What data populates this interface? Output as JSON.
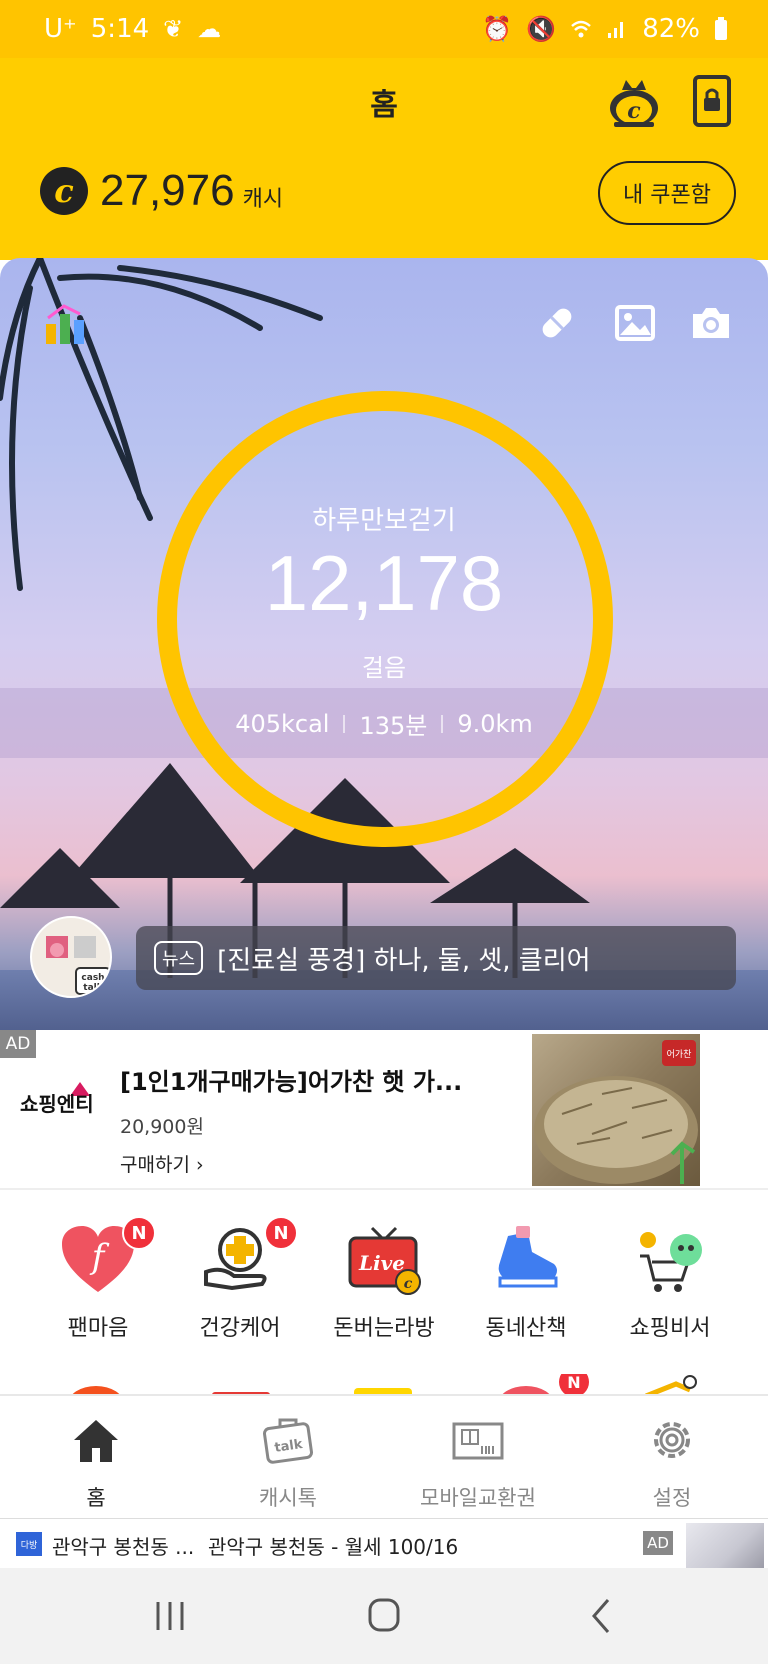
{
  "status_bar": {
    "carrier": "U⁺",
    "time": "5:14",
    "battery": "82%"
  },
  "header": {
    "title": "홈",
    "cash_amount": "27,976",
    "cash_unit": "캐시",
    "coupon_label": "내 쿠폰함",
    "accent_color": "#ffcd00"
  },
  "walk": {
    "title": "하루만보걷기",
    "steps": "12,178",
    "steps_unit": "걸음",
    "kcal": "405kcal",
    "minutes": "135분",
    "distance": "9.0km"
  },
  "news": {
    "tag": "뉴스",
    "text": "[진료실 풍경] 하나, 둘, 셋, 클리어"
  },
  "ad": {
    "badge": "AD",
    "brand": "쇼핑엔티",
    "title": "[1인1개구매가능]어가찬 햇 가...",
    "price": "20,900원",
    "buy_label": "구매하기",
    "image_label": "어가찬"
  },
  "shortcuts": [
    {
      "label": "팬마음",
      "icon": "heart-f-icon",
      "badge": "N"
    },
    {
      "label": "건강케어",
      "icon": "health-care-icon",
      "badge": "N"
    },
    {
      "label": "돈버는라방",
      "icon": "live-tv-icon",
      "badge": ""
    },
    {
      "label": "동네산책",
      "icon": "sneaker-icon",
      "badge": ""
    },
    {
      "label": "쇼핑비서",
      "icon": "shopping-cart-icon",
      "badge": ""
    }
  ],
  "bottom_nav": [
    {
      "label": "홈",
      "icon": "home-icon",
      "active": true
    },
    {
      "label": "캐시톡",
      "icon": "talk-bag-icon",
      "active": false
    },
    {
      "label": "모바일교환권",
      "icon": "voucher-icon",
      "active": false
    },
    {
      "label": "설정",
      "icon": "gear-icon",
      "active": false
    }
  ],
  "banner_ad": {
    "logo_text": "다방",
    "title": "관악구 봉천동 ...",
    "subtitle": "관악구 봉천동 - 월세 100/16",
    "badge": "AD"
  }
}
